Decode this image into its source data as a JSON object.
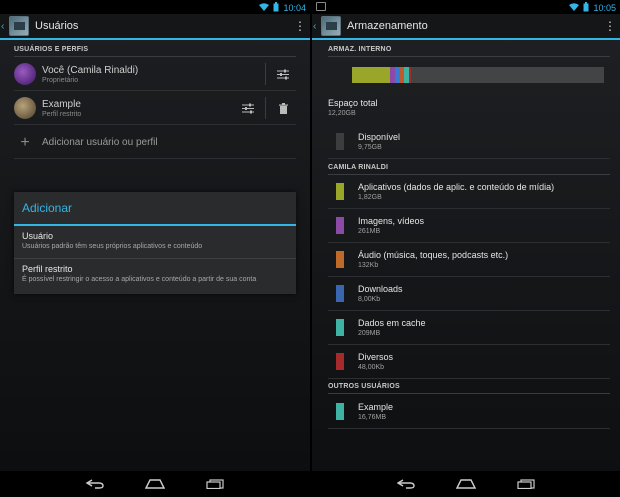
{
  "left": {
    "status_time": "10:04",
    "title": "Usuários",
    "section": "USUÁRIOS E PERFIS",
    "users": [
      {
        "name": "Você (Camila Rinaldi)",
        "sub": "Proprietário",
        "avatar_color": "#6a2d8f"
      },
      {
        "name": "Example",
        "sub": "Perfil restrito",
        "avatar_color": "#8b7a5a"
      }
    ],
    "add_label": "Adicionar usuário ou perfil",
    "dialog": {
      "title": "Adicionar",
      "items": [
        {
          "title": "Usuário",
          "sub": "Usuários padrão têm seus próprios aplicativos e conteúdo"
        },
        {
          "title": "Perfil restrito",
          "sub": "É possível restringir o acesso a aplicativos e conteúdo a partir de sua conta"
        }
      ]
    }
  },
  "right": {
    "status_time": "10:05",
    "title": "Armazenamento",
    "section_internal": "ARMAZ. INTERNO",
    "usage_bar": [
      {
        "color": "#9aa62a",
        "fraction": 0.15
      },
      {
        "color": "#8a4aa6",
        "fraction": 0.02
      },
      {
        "color": "#3a7ad0",
        "fraction": 0.02
      },
      {
        "color": "#c05a2a",
        "fraction": 0.015
      },
      {
        "color": "#3fb3a3",
        "fraction": 0.02
      },
      {
        "color": "#a52a2a",
        "fraction": 0.01
      }
    ],
    "total_label": "Espaço total",
    "total_value": "12,20GB",
    "available": {
      "label": "Disponível",
      "value": "9,75GB",
      "color": "#3c3d3f"
    },
    "section_user": "CAMILA RINALDI",
    "items": [
      {
        "label": "Aplicativos (dados de aplic. e conteúdo de mídia)",
        "value": "1,82GB",
        "color": "#9aa62a"
      },
      {
        "label": "Imagens, vídeos",
        "value": "261MB",
        "color": "#8a4aa6"
      },
      {
        "label": "Áudio (música, toques, podcasts etc.)",
        "value": "132Kb",
        "color": "#c06a2a"
      },
      {
        "label": "Downloads",
        "value": "8,00Kb",
        "color": "#3a66b0"
      },
      {
        "label": "Dados em cache",
        "value": "209MB",
        "color": "#3fb3a3"
      },
      {
        "label": "Diversos",
        "value": "48,00Kb",
        "color": "#a52a2a"
      }
    ],
    "section_others": "OUTROS USUÁRIOS",
    "others": [
      {
        "label": "Example",
        "value": "16,76MB",
        "color": "#3fb3a3"
      }
    ]
  }
}
